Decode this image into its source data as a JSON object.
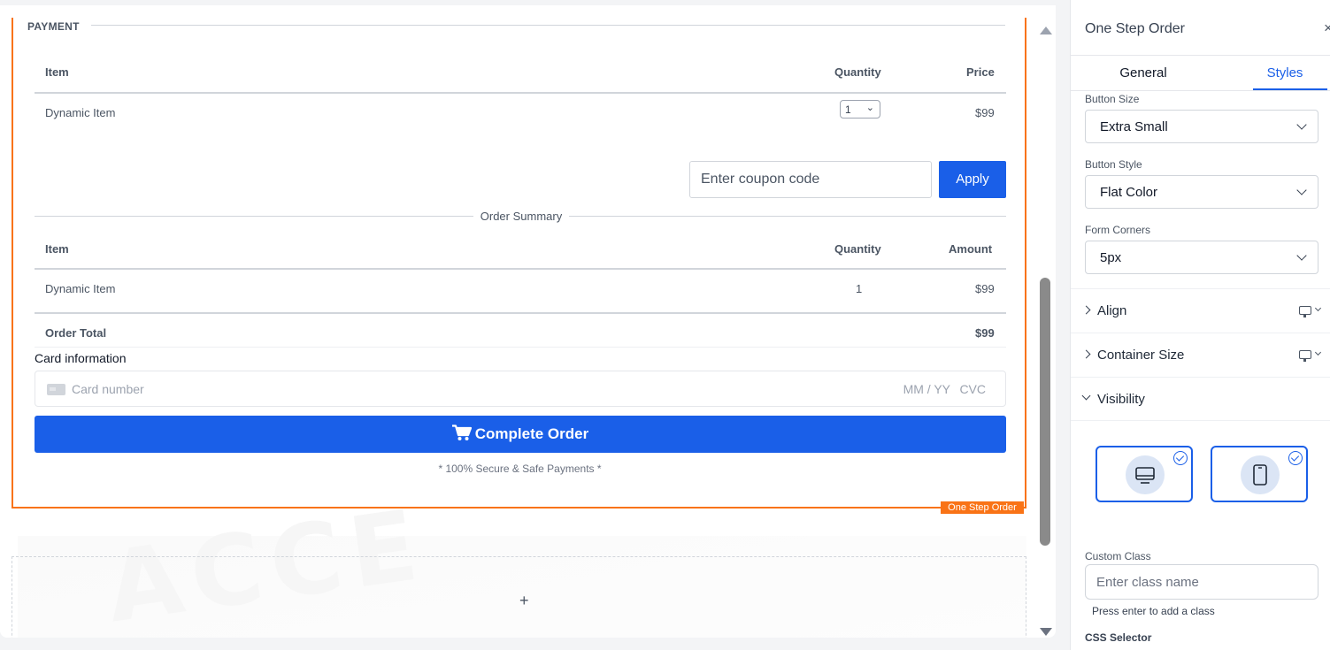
{
  "canvas": {
    "section_legend": "PAYMENT",
    "items_table": {
      "headers": [
        "Item",
        "Quantity",
        "Price"
      ],
      "row": {
        "item": "Dynamic Item",
        "quantity": "1",
        "price": "$99"
      }
    },
    "coupon": {
      "placeholder": "Enter coupon code",
      "apply_label": "Apply"
    },
    "summary": {
      "title": "Order Summary",
      "headers": [
        "Item",
        "Quantity",
        "Amount"
      ],
      "row": {
        "item": "Dynamic Item",
        "quantity": "1",
        "amount": "$99"
      },
      "total_label": "Order Total",
      "total_value": "$99"
    },
    "card": {
      "label": "Card information",
      "number_placeholder": "Card number",
      "expiry_placeholder": "MM / YY",
      "cvc_placeholder": "CVC"
    },
    "complete_label": "Complete Order",
    "secure_note": "* 100% Secure & Safe Payments *",
    "widget_tag": "One Step Order",
    "add_block": "+",
    "watermark": "ACCE",
    "accent_color": "#f97316",
    "button_color": "#1a5fe8"
  },
  "panel": {
    "title": "One Step Order",
    "close_icon": "×",
    "tabs": {
      "general": "General",
      "styles": "Styles"
    },
    "active_tab": "Styles",
    "fields": {
      "button_size": {
        "label": "Button Size",
        "value": "Extra Small"
      },
      "button_style": {
        "label": "Button Style",
        "value": "Flat Color"
      },
      "form_corners": {
        "label": "Form Corners",
        "value": "5px"
      }
    },
    "accordions": {
      "align": "Align",
      "container_size": "Container Size",
      "visibility": "Visibility"
    },
    "visibility": {
      "desktop_checked": true,
      "mobile_checked": true
    },
    "custom_class": {
      "label": "Custom Class",
      "placeholder": "Enter class name",
      "help": "Press enter to add a class"
    },
    "css_selector_label": "CSS Selector"
  }
}
